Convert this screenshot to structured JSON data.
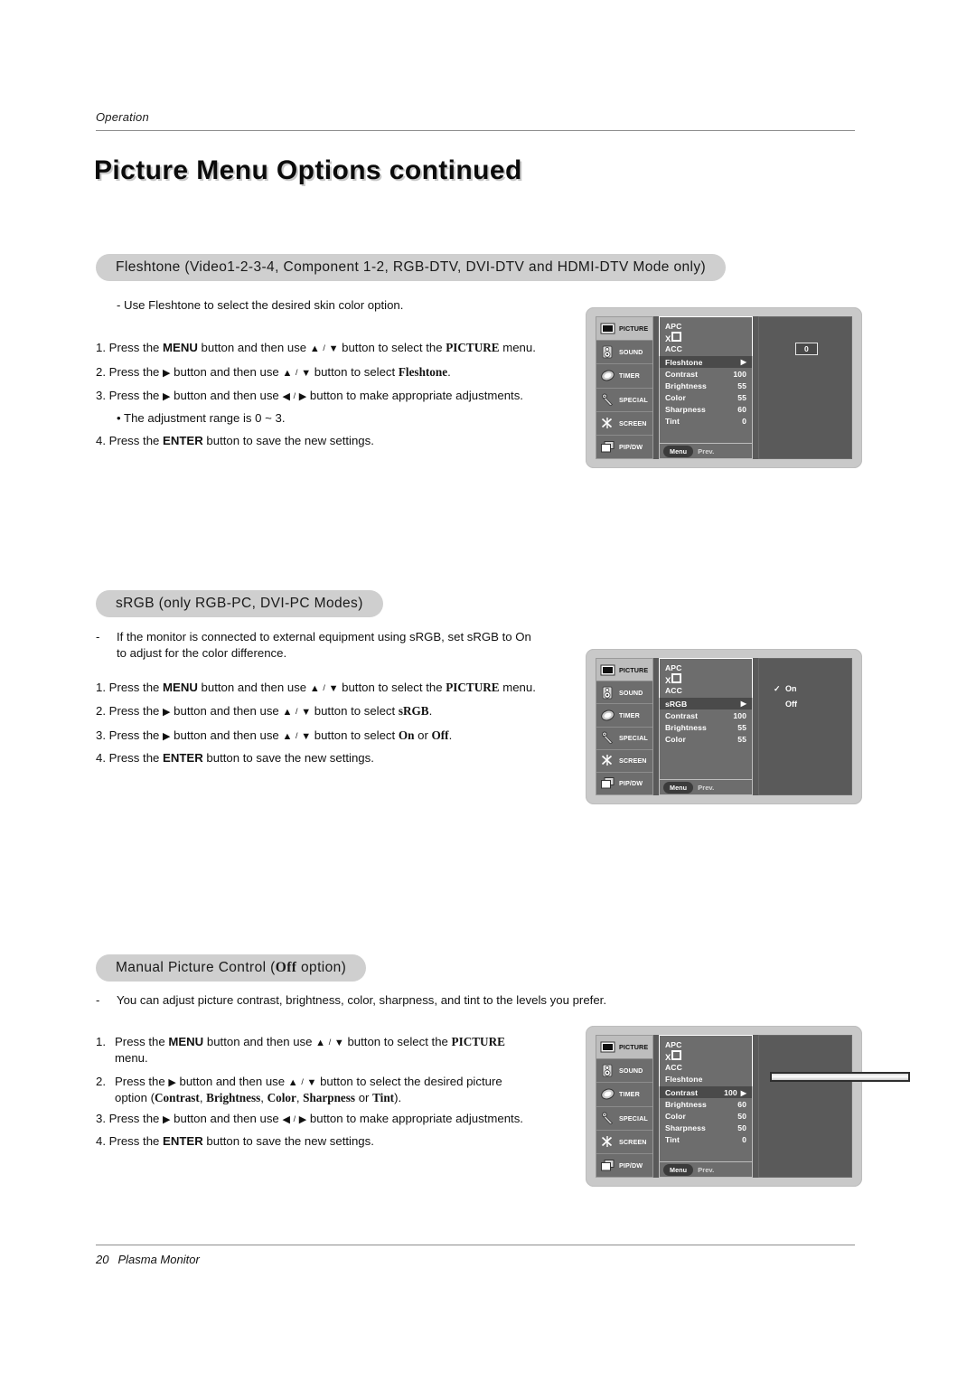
{
  "header": {
    "section_label": "Operation",
    "title": "Picture Menu Options continued"
  },
  "footer": {
    "page_number": "20",
    "product": "Plasma Monitor"
  },
  "sections": [
    {
      "heading": "Fleshtone (Video1-2-3-4, Component 1-2, RGB-DTV, DVI-DTV and HDMI-DTV Mode only)",
      "bullet": "-   Use Fleshtone to select the desired skin color option.",
      "steps": [
        "1.  Press the MENU button and then use ▲ / ▼  button to select the PICTURE menu.",
        "2.  Press the ▶  button and then use ▲ / ▼ button to select Fleshtone.",
        "3.  Press the ▶ button and then use ◀ / ▶ button to make appropriate adjustments.",
        "• The adjustment range is 0 ~ 3.",
        "4.  Press the ENTER button to save the new settings."
      ]
    },
    {
      "heading": "sRGB (only RGB-PC, DVI-PC Modes)",
      "bullet": "-   If the monitor is connected to external equipment using sRGB, set sRGB to On to adjust for the color difference.",
      "steps": [
        "1.  Press the MENU button and then use ▲ / ▼  button to select the PICTURE menu.",
        "2.  Press the ▶  button and then use ▲ / ▼ button to select sRGB.",
        "3.  Press the ▶  button and then use ▲ / ▼ button to select On or Off.",
        "4.  Press the ENTER button to save the new settings."
      ]
    },
    {
      "heading": "Manual Picture Control (Off option)",
      "bullet": "-   You can adjust picture contrast, brightness, color, sharpness, and tint to the levels you prefer.",
      "steps": [
        "1.  Press the MENU button and then use ▲ / ▼  button to select the PICTURE menu.",
        "2.  Press the ▶  button and then use ▲ / ▼ button to select the desired picture option (Contrast, Brightness, Color, Sharpness or Tint).",
        "3.  Press the ▶ button and then use ◀ / ▶ button to make appropriate adjustments.",
        "4.  Press the ENTER button to save the new settings."
      ]
    }
  ],
  "osd_common": {
    "rail": [
      {
        "label": "PICTURE",
        "icon": "picture-icon",
        "selected": true
      },
      {
        "label": "SOUND",
        "icon": "speaker-icon",
        "selected": false
      },
      {
        "label": "TIMER",
        "icon": "clock-icon",
        "selected": false
      },
      {
        "label": "SPECIAL",
        "icon": "wrench-icon",
        "selected": false
      },
      {
        "label": "SCREEN",
        "icon": "scissors-icon",
        "selected": false
      },
      {
        "label": "PIP/DW",
        "icon": "pip-windows-icon",
        "selected": false
      }
    ],
    "menu_button": "Menu",
    "prev_label": "Prev.",
    "xd_logo": "XD"
  },
  "osd_fleshtone": {
    "top_items": [
      "APC",
      "XD",
      "ACC"
    ],
    "rows": [
      {
        "label": "Fleshtone",
        "value": "",
        "arrow": true,
        "highlight": true
      },
      {
        "label": "Contrast",
        "value": "100",
        "arrow": false,
        "highlight": false
      },
      {
        "label": "Brightness",
        "value": "55",
        "arrow": false,
        "highlight": false
      },
      {
        "label": "Color",
        "value": "55",
        "arrow": false,
        "highlight": false
      },
      {
        "label": "Sharpness",
        "value": "60",
        "arrow": false,
        "highlight": false
      },
      {
        "label": "Tint",
        "value": "0",
        "arrow": false,
        "highlight": false
      }
    ],
    "pane_type": "value-box",
    "pane_value": "0"
  },
  "osd_srgb": {
    "top_items": [
      "APC",
      "XD",
      "ACC"
    ],
    "rows": [
      {
        "label": "sRGB",
        "value": "",
        "arrow": true,
        "highlight": true
      },
      {
        "label": "Contrast",
        "value": "100",
        "arrow": false,
        "highlight": false
      },
      {
        "label": "Brightness",
        "value": "55",
        "arrow": false,
        "highlight": false
      },
      {
        "label": "Color",
        "value": "55",
        "arrow": false,
        "highlight": false
      }
    ],
    "pane_type": "option-list",
    "options": [
      {
        "label": "On",
        "checked": true
      },
      {
        "label": "Off",
        "checked": false
      }
    ]
  },
  "osd_manual": {
    "top_items": [
      "APC",
      "XD",
      "ACC",
      "Fleshtone"
    ],
    "rows": [
      {
        "label": "Contrast",
        "value": "100",
        "arrow": true,
        "highlight": true
      },
      {
        "label": "Brightness",
        "value": "60",
        "arrow": false,
        "highlight": false
      },
      {
        "label": "Color",
        "value": "50",
        "arrow": false,
        "highlight": false
      },
      {
        "label": "Sharpness",
        "value": "50",
        "arrow": false,
        "highlight": false
      },
      {
        "label": "Tint",
        "value": "0",
        "arrow": false,
        "highlight": false
      }
    ],
    "pane_type": "slider",
    "slider_percent": 100
  },
  "colors": {
    "pill_bg": "#cfcfcf",
    "osd_frame": "#c9c9c9",
    "osd_screen": "#5a5a5a",
    "osd_panel": "#6d6d6d",
    "osd_highlight": "#4a4a4a",
    "osd_selected_rail": "#bdbdbd"
  }
}
